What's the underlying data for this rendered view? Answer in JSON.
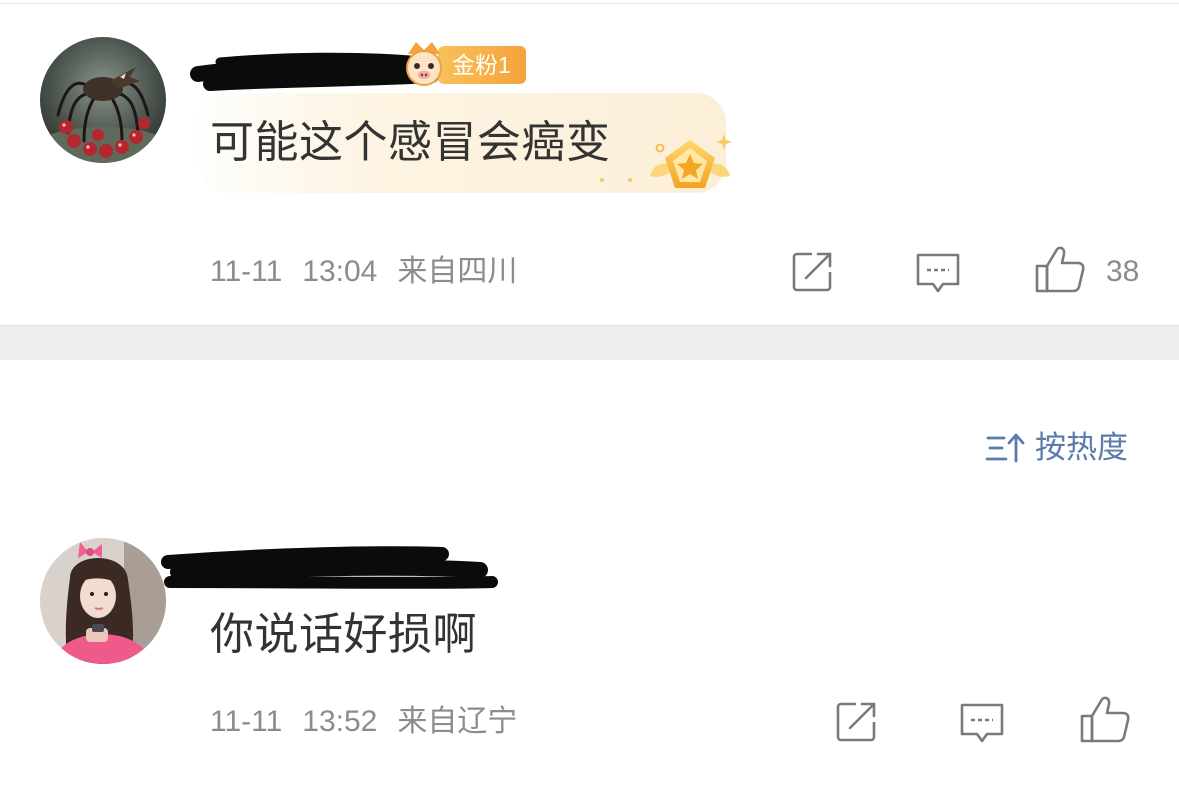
{
  "comments": [
    {
      "fan_badge": {
        "label": "金粉1",
        "icon": "fan-badge-icon"
      },
      "text": "可能这个感冒会癌变",
      "highlight_icon": "gold-medal-icon",
      "date": "11-11",
      "time": "13:04",
      "location": "来自四川",
      "like_count": "38"
    },
    {
      "text": "你说话好损啊",
      "date": "11-11",
      "time": "13:52",
      "location": "来自辽宁"
    }
  ],
  "sort_toggle": {
    "label": "按热度",
    "icon": "sort-icon"
  },
  "action_icons": [
    "share-icon",
    "comment-icon",
    "like-icon"
  ],
  "colors": {
    "text": "#333333",
    "meta_gray": "#8c8c8c",
    "accent_blue": "#5a7bab",
    "badge_orange": "#f5a23a",
    "bubble": "#fcefd8",
    "divider": "#efefef"
  }
}
